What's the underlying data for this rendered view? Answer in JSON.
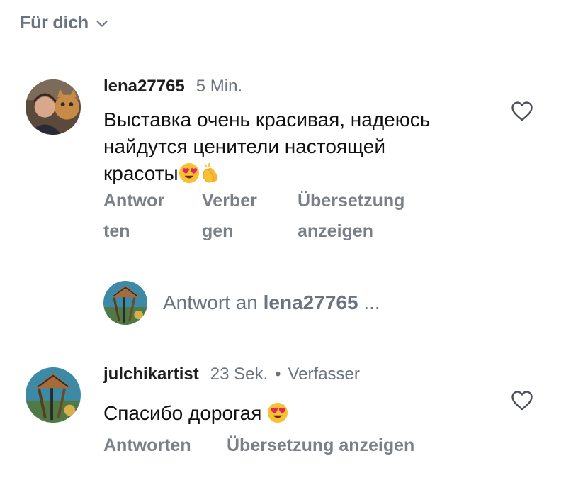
{
  "header": {
    "title": "Für dich"
  },
  "comments": [
    {
      "username": "lena27765",
      "time": "5 Min.",
      "text": "Выставка очень красивая, надеюсь найдутся ценители настоящей",
      "text_last": "красоты",
      "emojis": [
        "heart-eyes",
        "clapping-hands"
      ],
      "actions": {
        "reply_1": "Antwor",
        "reply_2": "ten",
        "hide_1": "Verber",
        "hide_2": "gen",
        "translate_1": "Übersetzung",
        "translate_2": "anzeigen"
      }
    },
    {
      "username": "julchikartist",
      "time": "23 Sek.",
      "separator": "•",
      "tag": "Verfasser",
      "text": "Спасибо дорогая",
      "emojis": [
        "heart-eyes"
      ],
      "actions": {
        "reply": "Antworten",
        "translate": "Übersetzung anzeigen"
      }
    }
  ],
  "reply_box": {
    "prefix": "Antwort an",
    "target": "lena27765",
    "suffix": "..."
  },
  "colors": {
    "muted": "#6b7280",
    "action": "#7a7f88",
    "text": "#111111",
    "emoji_yellow": "#f9c031",
    "heart_red": "#e0245e"
  }
}
